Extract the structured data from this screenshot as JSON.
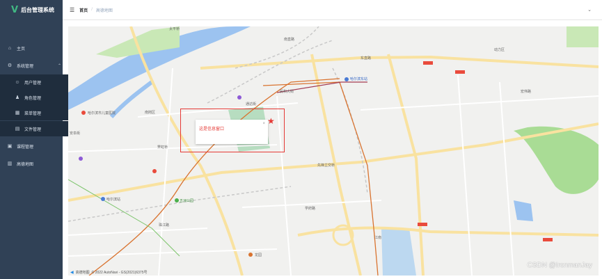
{
  "sidebar": {
    "logo": "V",
    "title": "后台管理系统",
    "items": [
      {
        "label": "主页",
        "icon": "home-icon"
      },
      {
        "label": "系统管理",
        "icon": "settings-icon"
      },
      {
        "label": "用户管理",
        "icon": "user-icon"
      },
      {
        "label": "角色管理",
        "icon": "role-icon"
      },
      {
        "label": "菜单管理",
        "icon": "menu-grid-icon"
      },
      {
        "label": "文件管理",
        "icon": "file-icon"
      },
      {
        "label": "课程管理",
        "icon": "course-icon"
      },
      {
        "label": "高德地图",
        "icon": "map-icon"
      }
    ],
    "bg_color": "#304156"
  },
  "header": {
    "breadcrumb": [
      "首页",
      "高德地图"
    ]
  },
  "map": {
    "popup_text": "这是信息窗口",
    "popup_close": "×",
    "attribution_brand": "高德地图",
    "attribution": "© 2022 AutoNavi - GS(2021)6375号",
    "labels": [
      "哈尔滨东站",
      "哈尔滨市儿童医院",
      "哈尔滨站",
      "先锋立交桥",
      "南直路",
      "东直路",
      "动力区",
      "太平桥",
      "民和大街",
      "五洲公园",
      "南岗区",
      "学府路",
      "安阜街",
      "宏伟路",
      "霁虹桥",
      "通达街",
      "珠江路",
      "龙园",
      "江南"
    ],
    "marker_icon": "star-icon",
    "highlight_color": "#e53935"
  },
  "watermark": "CSDN @IronmanJay"
}
